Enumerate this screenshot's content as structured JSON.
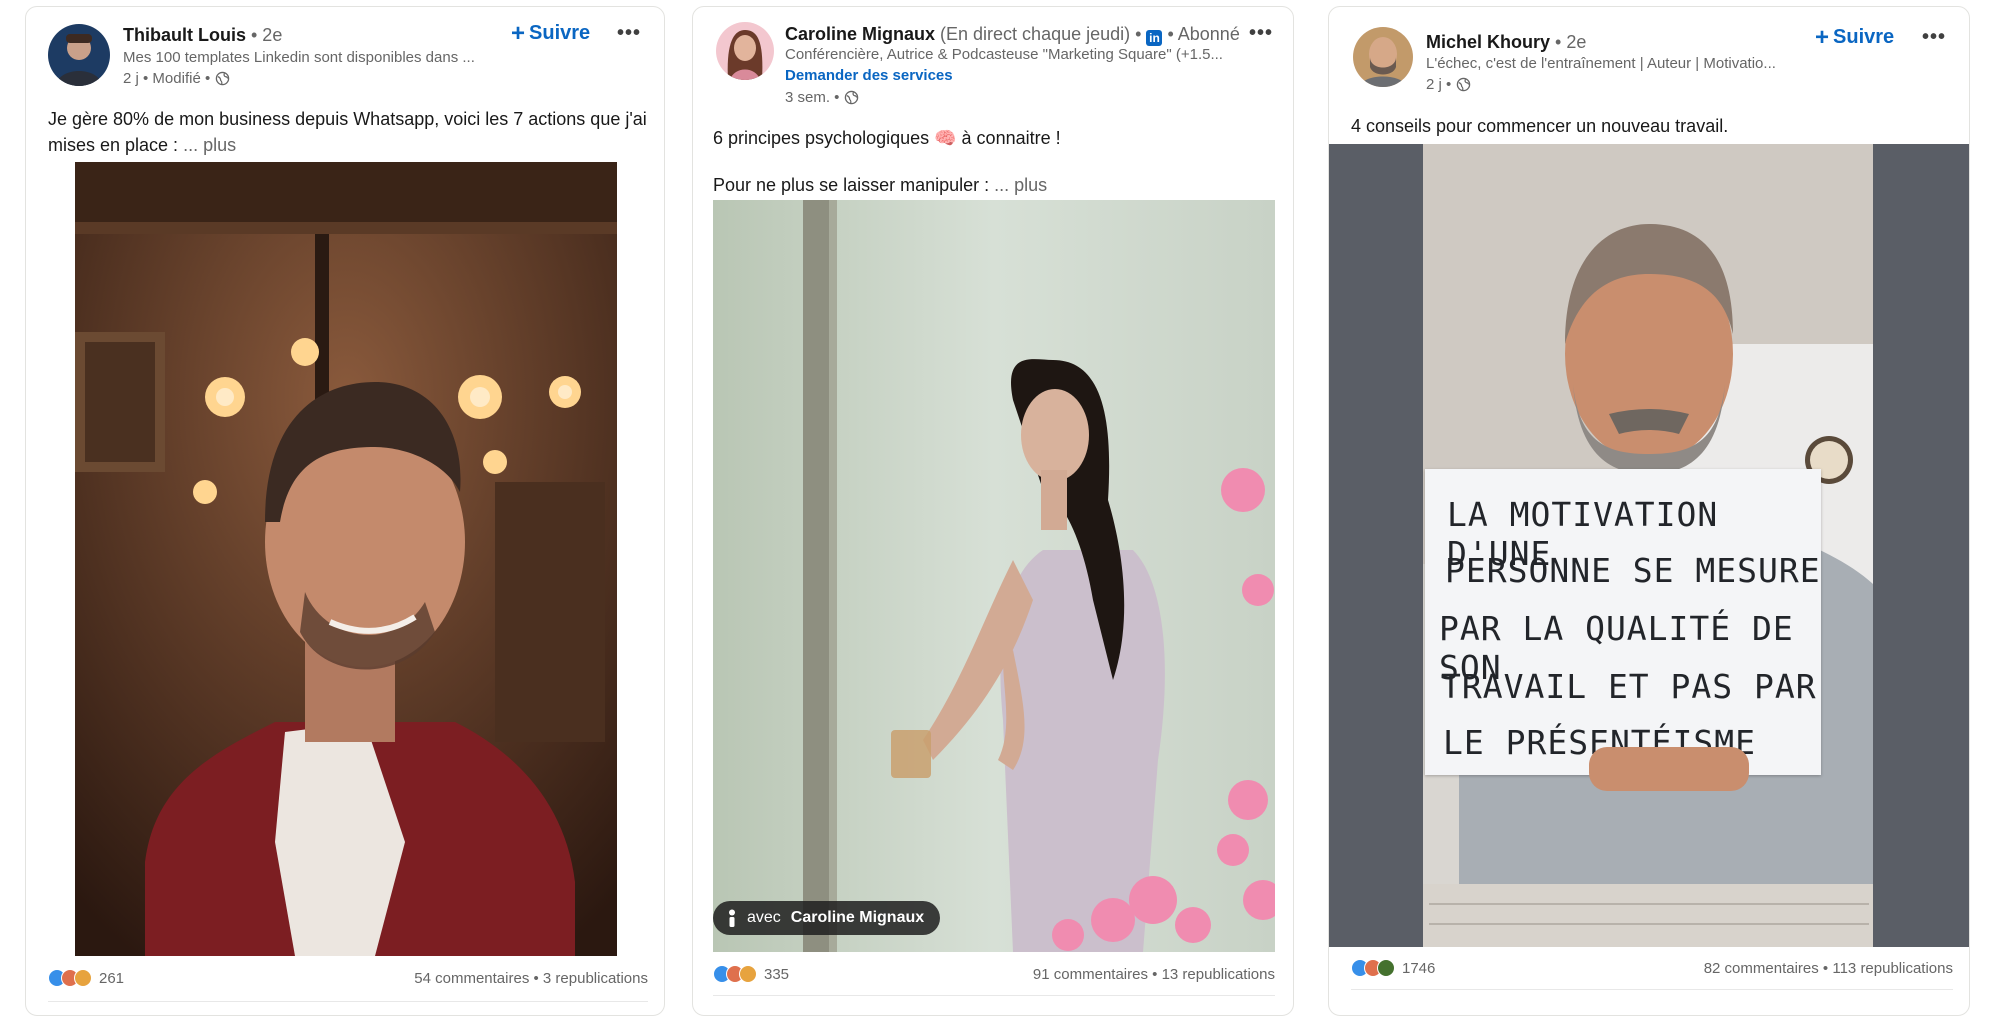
{
  "colors": {
    "accent": "#0a66c2",
    "like": "#378fe9",
    "celebrate": "#df704d",
    "support": "#e7a33e",
    "insightful": "#44712e"
  },
  "posts": [
    {
      "author": "Thibault Louis",
      "degree": " • 2e",
      "headline": "Mes 100 templates Linkedin sont disponibles dans ...",
      "meta": "2 j • Modifié •",
      "follow_label": "Suivre",
      "text": "Je gère 80% de mon business depuis Whatsapp, voici les 7 actions que j'ai mises en place :",
      "see_more": "... plus",
      "reaction_icons": [
        "like",
        "celebrate",
        "support"
      ],
      "reactions_count": "261",
      "comments": "54 commentaires",
      "separator": " • ",
      "reposts": "3 republications"
    },
    {
      "author": "Caroline Mignaux",
      "author_suffix": " (En direct chaque jeudi) • ",
      "linkedin_badge": "in",
      "follow_status": " • Abonné",
      "headline": "Conférencière, Autrice & Podcasteuse \"Marketing Square\" (+1.5...",
      "services_link": "Demander des services",
      "meta": "3 sem. •",
      "text_line1": "6 principes psychologiques 🧠 à connaitre !",
      "text_line2": "Pour ne plus se laisser manipuler :",
      "see_more": "... plus",
      "tag_prefix": "avec",
      "tag_name": "Caroline Mignaux",
      "reaction_icons": [
        "like",
        "celebrate",
        "support"
      ],
      "reactions_count": "335",
      "comments": "91 commentaires",
      "separator": " • ",
      "reposts": "13 republications"
    },
    {
      "author": "Michel Khoury",
      "degree": " • 2e",
      "headline": "L'échec, c'est de l'entraînement | Auteur | Motivatio...",
      "meta": "2 j •",
      "follow_label": "Suivre",
      "text": "4 conseils pour commencer un nouveau travail.",
      "sign_lines": [
        "LA MOTIVATION D'UNE",
        "PERSONNE SE MESURE",
        "PAR LA QUALITÉ DE SON",
        "TRAVAIL ET PAS PAR",
        "LE PRÉSENTÉISME"
      ],
      "reaction_icons": [
        "like",
        "celebrate",
        "insightful"
      ],
      "reactions_count": "1746",
      "comments": "82 commentaires",
      "separator": " • ",
      "reposts": "113 republications"
    }
  ]
}
